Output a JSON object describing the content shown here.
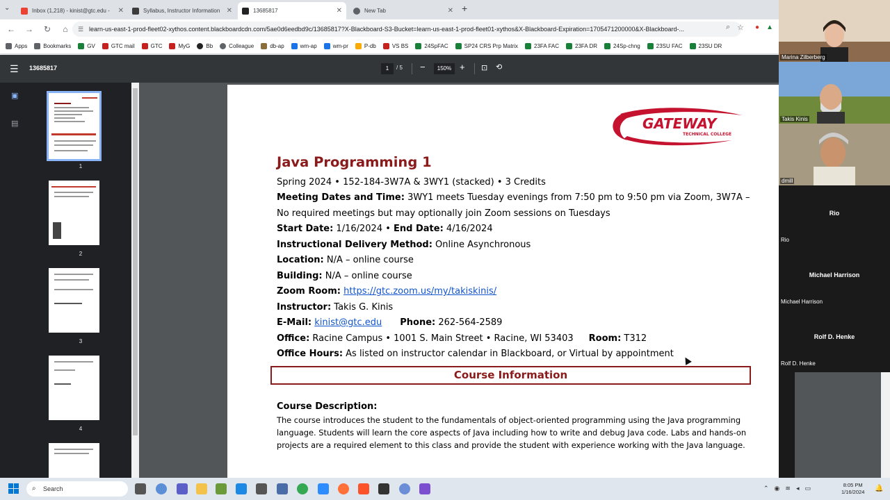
{
  "browser": {
    "tabs": [
      {
        "title": "Inbox (1,218) - kinist@gtc.edu -",
        "favicon_color": "#ea4335",
        "active": false
      },
      {
        "title": "Syllabus, Instructor Information",
        "favicon_color": "#3c3c3c",
        "active": false
      },
      {
        "title": "13685817",
        "favicon_color": "#222222",
        "active": true
      },
      {
        "title": "New Tab",
        "favicon_color": "#5f6368",
        "active": false
      }
    ],
    "url": "learn-us-east-1-prod-fleet02-xythos.content.blackboardcdn.com/5ae0d6eedbd9c/13685817?X-Blackboard-S3-Bucket=learn-us-east-1-prod-fleet01-xythos&X-Blackboard-Expiration=1705471200000&X-Blackboard-...",
    "bookmarks": [
      {
        "label": "Apps",
        "color": "#5f6368"
      },
      {
        "label": "Bookmarks",
        "color": "#5f6368"
      },
      {
        "label": "GV",
        "color": "#188038"
      },
      {
        "label": "GTC mail",
        "color": "#c5221f"
      },
      {
        "label": "GTC",
        "color": "#c5221f"
      },
      {
        "label": "MyG",
        "color": "#c5221f"
      },
      {
        "label": "Bb",
        "color": "#222222"
      },
      {
        "label": "Colleague",
        "color": "#5f6368"
      },
      {
        "label": "db-ap",
        "color": "#8a6d3b"
      },
      {
        "label": "wm-ap",
        "color": "#1a73e8"
      },
      {
        "label": "wm-pr",
        "color": "#1a73e8"
      },
      {
        "label": "P-db",
        "color": "#f9ab00"
      },
      {
        "label": "VS BS",
        "color": "#c5221f"
      },
      {
        "label": "24SpFAC",
        "color": "#188038"
      },
      {
        "label": "SP24 CRS Prp Matrix",
        "color": "#188038"
      },
      {
        "label": "23FA FAC",
        "color": "#188038"
      },
      {
        "label": "23FA DR",
        "color": "#188038"
      },
      {
        "label": "24Sp-chng",
        "color": "#188038"
      },
      {
        "label": "23SU FAC",
        "color": "#188038"
      },
      {
        "label": "23SU DR",
        "color": "#188038"
      }
    ]
  },
  "pdf": {
    "doc_title": "13685817",
    "current_page": "1",
    "total_pages": "/ 5",
    "zoom": "150%",
    "thumb_labels": [
      "1",
      "2",
      "3",
      "4"
    ]
  },
  "doc": {
    "title": "Java Programming 1",
    "line1": "Spring 2024 • 152-184-3W7A & 3WY1 (stacked)  • 3 Credits",
    "meeting_label": "Meeting Dates and Time:",
    "meeting_value": " 3WY1 meets Tuesday evenings from 7:50 pm to 9:50 pm via Zoom, 3W7A –",
    "meeting_value2": "No required meetings but may optionally join Zoom sessions on Tuesdays",
    "start_label": "Start Date:",
    "start_value": " 1/16/2024 • ",
    "end_label": "End Date:",
    "end_value": " 4/16/2024",
    "delivery_label": "Instructional Delivery Method:",
    "delivery_value": "  Online Asynchronous",
    "location_label": "Location:",
    "location_value": " N/A – online course",
    "building_label": "Building:",
    "building_value": " N/A – online course",
    "zoom_label": "Zoom Room:",
    "zoom_link": "https://gtc.zoom.us/my/takiskinis/",
    "instructor_label": "Instructor:",
    "instructor_value": "  Takis G. Kinis",
    "email_label": "E-Mail:",
    "email_link": "kinist@gtc.edu",
    "phone_label": "Phone:",
    "phone_value": " 262-564-2589",
    "office_label": "Office:",
    "office_value": " Racine Campus • 1001 S. Main Street • Racine, WI 53403",
    "room_label": "Room:",
    "room_value": " T312",
    "hours_label": "Office Hours:",
    "hours_value": " As listed on instructor calendar in Blackboard, or Virtual by appointment",
    "section_header": "Course Information",
    "desc_title": "Course Description:",
    "desc_text": "The course introduces the student to the fundamentals of object-oriented programming using the Java programming language. Students will learn the core aspects of Java including how to write and debug Java code. Labs and hands-on projects are a required element to this class and provide the student with experience working with the Java language.",
    "logo_text": "GATEWAY",
    "logo_sub": "TECHNICAL COLLEGE"
  },
  "participants": [
    {
      "name": "Marina Zilberberg",
      "video": true,
      "bg": "#d8c8b8"
    },
    {
      "name": "Takis Kinis",
      "video": true,
      "bg": "#7aa7d8"
    },
    {
      "name": "dmill",
      "video": true,
      "bg": "#9a8c74"
    },
    {
      "name": "Rio",
      "video": false
    },
    {
      "name": "Michael Harrison",
      "video": false
    },
    {
      "name": "Rolf D. Henke",
      "video": false
    }
  ],
  "taskbar": {
    "search_placeholder": "Search",
    "time": "8:05 PM",
    "date": "1/16/2024"
  }
}
